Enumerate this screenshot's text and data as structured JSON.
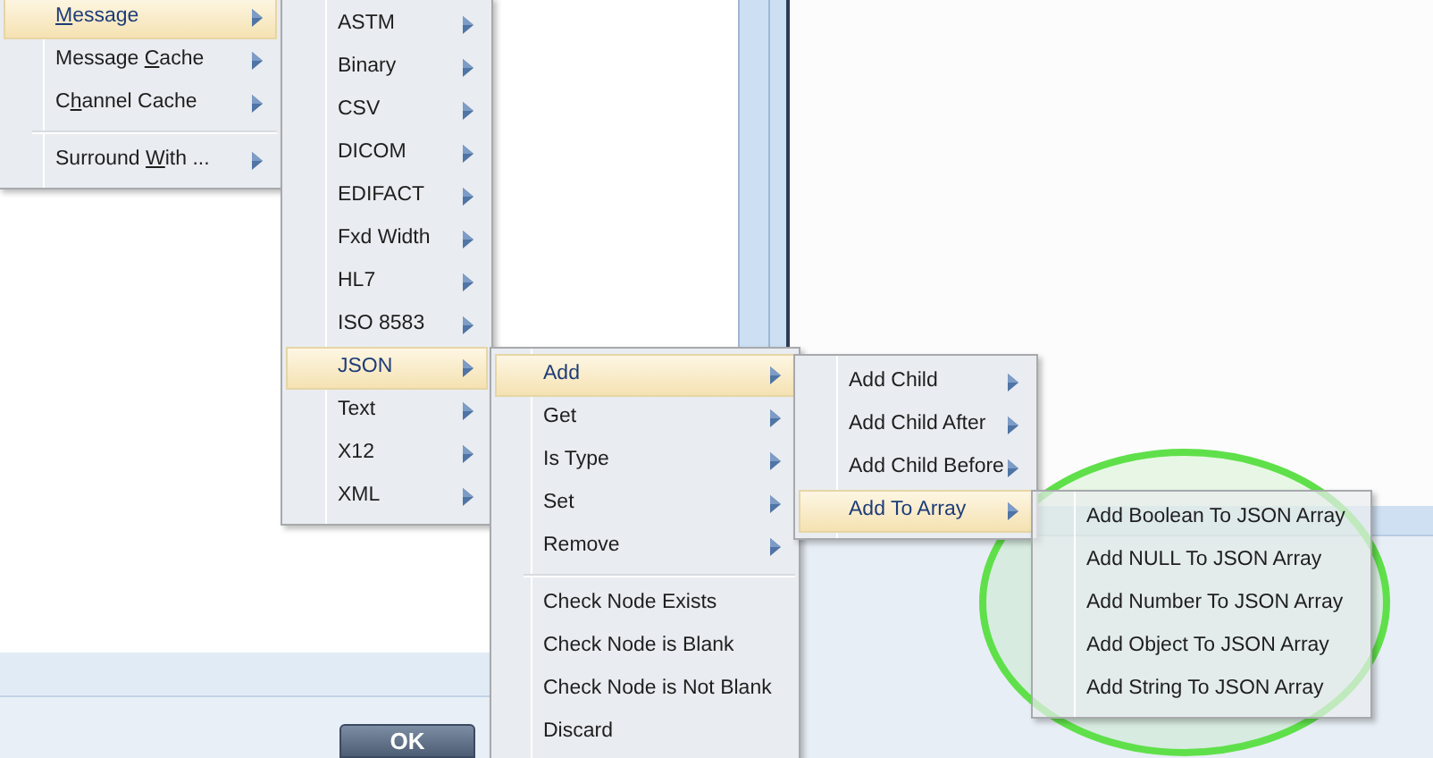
{
  "menus": [
    {
      "items": [
        {
          "kind": "item",
          "label_parts": [
            {
              "text": "M",
              "underlined": true
            },
            {
              "text": "essage",
              "underlined": false
            }
          ],
          "has_submenu": true,
          "selected": true
        },
        {
          "kind": "item",
          "label_parts": [
            {
              "text": "Message ",
              "underlined": false
            },
            {
              "text": "C",
              "underlined": true
            },
            {
              "text": "ache",
              "underlined": false
            }
          ],
          "has_submenu": true,
          "selected": false
        },
        {
          "kind": "item",
          "label_parts": [
            {
              "text": "C",
              "underlined": false
            },
            {
              "text": "h",
              "underlined": true
            },
            {
              "text": "annel Cache",
              "underlined": false
            }
          ],
          "has_submenu": true,
          "selected": false
        },
        {
          "kind": "separator"
        },
        {
          "kind": "item",
          "label_parts": [
            {
              "text": "Surround ",
              "underlined": false
            },
            {
              "text": "W",
              "underlined": true
            },
            {
              "text": "ith ...",
              "underlined": false
            }
          ],
          "has_submenu": true,
          "selected": false
        }
      ]
    },
    {
      "items": [
        {
          "kind": "item",
          "label": "ASTM",
          "has_submenu": true,
          "selected": false
        },
        {
          "kind": "item",
          "label": "Binary",
          "has_submenu": true,
          "selected": false
        },
        {
          "kind": "item",
          "label": "CSV",
          "has_submenu": true,
          "selected": false
        },
        {
          "kind": "item",
          "label": "DICOM",
          "has_submenu": true,
          "selected": false
        },
        {
          "kind": "item",
          "label": "EDIFACT",
          "has_submenu": true,
          "selected": false
        },
        {
          "kind": "item",
          "label": "Fxd Width",
          "has_submenu": true,
          "selected": false
        },
        {
          "kind": "item",
          "label": "HL7",
          "has_submenu": true,
          "selected": false
        },
        {
          "kind": "item",
          "label": "ISO 8583",
          "has_submenu": true,
          "selected": false
        },
        {
          "kind": "item",
          "label": "JSON",
          "has_submenu": true,
          "selected": true
        },
        {
          "kind": "item",
          "label": "Text",
          "has_submenu": true,
          "selected": false
        },
        {
          "kind": "item",
          "label": "X12",
          "has_submenu": true,
          "selected": false
        },
        {
          "kind": "item",
          "label": "XML",
          "has_submenu": true,
          "selected": false
        }
      ]
    },
    {
      "items": [
        {
          "kind": "item",
          "label": "Add",
          "has_submenu": true,
          "selected": true
        },
        {
          "kind": "item",
          "label": "Get",
          "has_submenu": true,
          "selected": false
        },
        {
          "kind": "item",
          "label": "Is Type",
          "has_submenu": true,
          "selected": false
        },
        {
          "kind": "item",
          "label": "Set",
          "has_submenu": true,
          "selected": false
        },
        {
          "kind": "item",
          "label": "Remove",
          "has_submenu": true,
          "selected": false
        },
        {
          "kind": "separator"
        },
        {
          "kind": "item",
          "label": "Check Node Exists",
          "has_submenu": false,
          "selected": false
        },
        {
          "kind": "item",
          "label": "Check Node is Blank",
          "has_submenu": false,
          "selected": false
        },
        {
          "kind": "item",
          "label": "Check Node is Not Blank",
          "has_submenu": false,
          "selected": false
        },
        {
          "kind": "item",
          "label": "Discard",
          "has_submenu": false,
          "selected": false
        }
      ]
    },
    {
      "items": [
        {
          "kind": "item",
          "label": "Add Child",
          "has_submenu": true,
          "selected": false
        },
        {
          "kind": "item",
          "label": "Add Child After",
          "has_submenu": true,
          "selected": false
        },
        {
          "kind": "item",
          "label": "Add Child Before",
          "has_submenu": true,
          "selected": false
        },
        {
          "kind": "item",
          "label": "Add To Array",
          "has_submenu": true,
          "selected": true
        }
      ]
    },
    {
      "items": [
        {
          "kind": "item",
          "label": "Add Boolean To JSON Array",
          "has_submenu": false,
          "selected": false
        },
        {
          "kind": "item",
          "label": "Add NULL To JSON Array",
          "has_submenu": false,
          "selected": false
        },
        {
          "kind": "item",
          "label": "Add Number To JSON Array",
          "has_submenu": false,
          "selected": false
        },
        {
          "kind": "item",
          "label": "Add Object To JSON Array",
          "has_submenu": false,
          "selected": false
        },
        {
          "kind": "item",
          "label": "Add String To JSON Array",
          "has_submenu": false,
          "selected": false
        }
      ]
    }
  ],
  "dialog": {
    "ok_button": "OK"
  }
}
